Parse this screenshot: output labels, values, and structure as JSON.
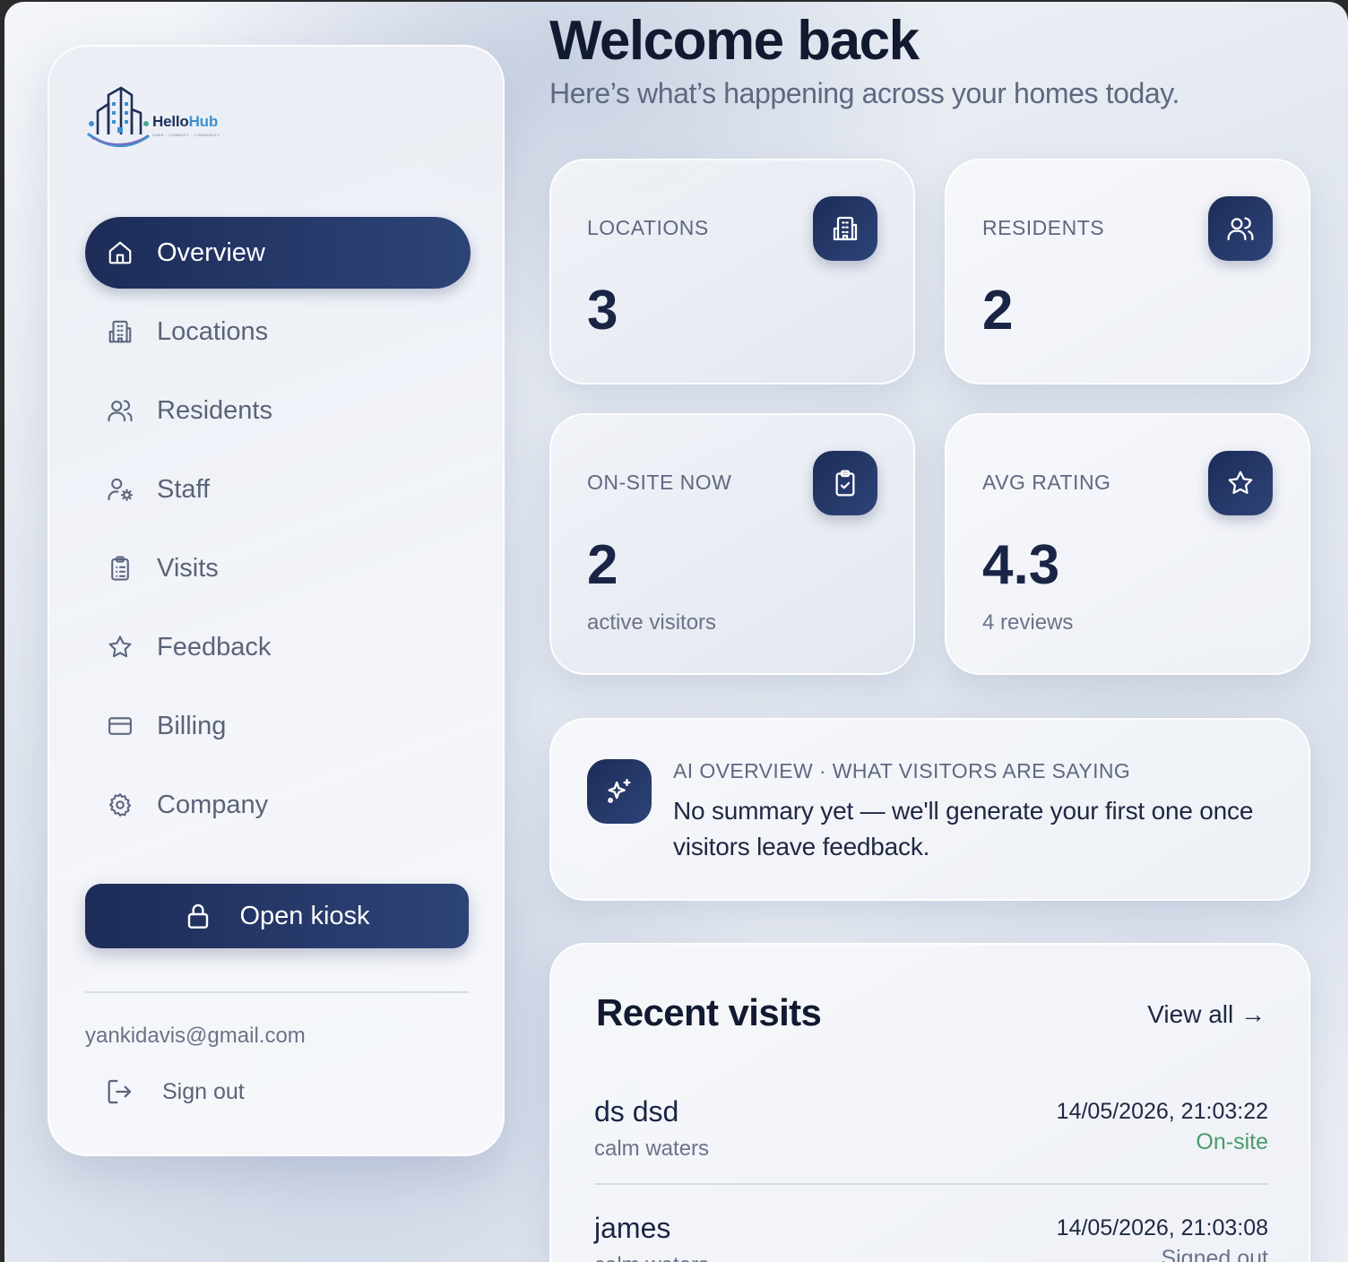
{
  "brand": {
    "name_part1": "Hello",
    "name_part2": "Hub",
    "tagline": "CARE · CONNECT · COMMUNITY"
  },
  "sidebar": {
    "items": [
      {
        "label": "Overview",
        "icon": "home-icon",
        "active": true
      },
      {
        "label": "Locations",
        "icon": "building-icon",
        "active": false
      },
      {
        "label": "Residents",
        "icon": "users-icon",
        "active": false
      },
      {
        "label": "Staff",
        "icon": "user-cog-icon",
        "active": false
      },
      {
        "label": "Visits",
        "icon": "clipboard-list-icon",
        "active": false
      },
      {
        "label": "Feedback",
        "icon": "star-icon",
        "active": false
      },
      {
        "label": "Billing",
        "icon": "credit-card-icon",
        "active": false
      },
      {
        "label": "Company",
        "icon": "gear-icon",
        "active": false
      }
    ],
    "kiosk_label": "Open kiosk",
    "email": "yankidavis@gmail.com",
    "signout_label": "Sign out"
  },
  "header": {
    "title": "Welcome back",
    "subtitle": "Here’s what’s happening across your homes today."
  },
  "stats": [
    {
      "label": "LOCATIONS",
      "value": "3",
      "icon": "building-icon"
    },
    {
      "label": "RESIDENTS",
      "value": "2",
      "icon": "users-icon"
    },
    {
      "label": "ON-SITE NOW",
      "value": "2",
      "sub": "active visitors",
      "icon": "clipboard-check-icon"
    },
    {
      "label": "AVG RATING",
      "value": "4.3",
      "sub": "4 reviews",
      "icon": "star-icon"
    }
  ],
  "ai": {
    "label": "AI OVERVIEW · WHAT VISITORS ARE SAYING",
    "text": "No summary yet — we'll generate your first one once visitors leave feedback.",
    "icon": "sparkles-icon"
  },
  "recent": {
    "title": "Recent visits",
    "view_all": "View all →",
    "visits": [
      {
        "name": "ds dsd",
        "location": "calm waters",
        "time": "14/05/2026, 21:03:22",
        "status": "On-site",
        "status_color": "#4a9a6a"
      },
      {
        "name": "james",
        "location": "calm waters",
        "time": "14/05/2026, 21:03:08",
        "status": "Signed out",
        "status_color": "#6a7388"
      }
    ]
  },
  "colors": {
    "accent": "#1f2f5a",
    "accent_light": "#2d4478",
    "brand_blue": "#3e8fd0",
    "onsite_green": "#4a9a6a"
  }
}
